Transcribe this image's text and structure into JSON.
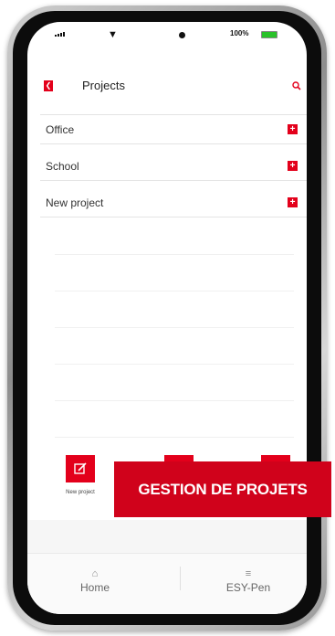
{
  "status_bar": {
    "battery_text": "100%",
    "battery_level": 1.0,
    "battery_color": "#29c229",
    "icons": [
      "signal-icon",
      "wifi-icon",
      "battery-icon"
    ]
  },
  "header": {
    "title": "Projects",
    "back_icon": "chevron-left-icon",
    "search_icon": "search-icon"
  },
  "projects": [
    {
      "label": "Office"
    },
    {
      "label": "School"
    },
    {
      "label": "New project"
    }
  ],
  "actions": {
    "new_project_label": "New project",
    "new_project_icon": "edit-icon"
  },
  "bottom_nav": {
    "home_label": "Home",
    "home_icon": "home-icon",
    "esy_label": "ESY-Pen",
    "esy_icon": "sliders-icon"
  },
  "banner": {
    "text": "GESTION DE PROJETS"
  },
  "colors": {
    "accent": "#e3001b",
    "banner": "#d0021b"
  }
}
